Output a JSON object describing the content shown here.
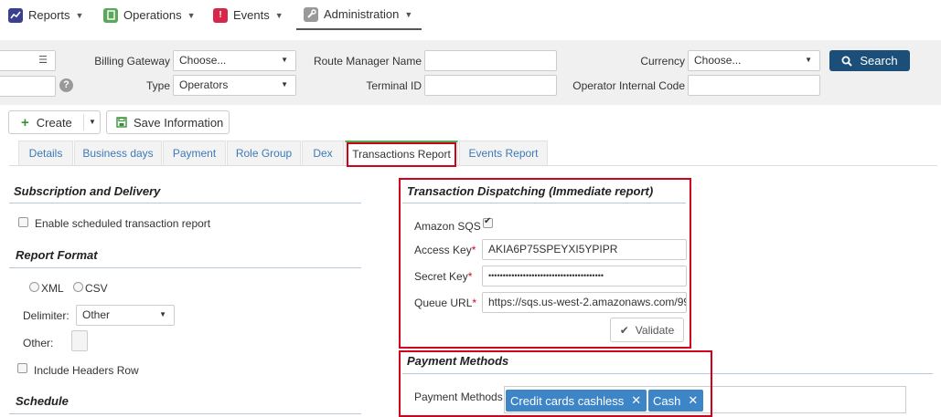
{
  "nav": {
    "reports": "Reports",
    "operations": "Operations",
    "events": "Events",
    "administration": "Administration"
  },
  "filters": {
    "billing_gateway_label": "Billing Gateway",
    "billing_gateway_value": "Choose...",
    "type_label": "Type",
    "type_value": "Operators",
    "route_manager_label": "Route Manager Name",
    "route_manager_value": "",
    "terminal_id_label": "Terminal ID",
    "terminal_id_value": "",
    "currency_label": "Currency",
    "currency_value": "Choose...",
    "operator_code_label": "Operator Internal Code",
    "operator_code_value": "",
    "search_label": "Search"
  },
  "toolbar": {
    "create_label": "Create",
    "save_label": "Save Information"
  },
  "tabs": [
    "Details",
    "Business days",
    "Payment",
    "Role Group",
    "Dex",
    "Transactions Report",
    "Events Report"
  ],
  "active_tab": "Transactions Report",
  "subscription": {
    "title": "Subscription and Delivery",
    "enable_label": "Enable scheduled transaction report",
    "enable_checked": false
  },
  "report_format": {
    "title": "Report Format",
    "xml_label": "XML",
    "csv_label": "CSV",
    "delimiter_label": "Delimiter:",
    "delimiter_value": "Other",
    "other_label": "Other:",
    "other_value": "",
    "headers_label": "Include Headers Row"
  },
  "schedule": {
    "title": "Schedule"
  },
  "dispatching": {
    "title": "Transaction Dispatching (Immediate report)",
    "sqs_label": "Amazon SQS",
    "sqs_checked": true,
    "access_key_label": "Access Key",
    "access_key_value": "AKIA6P75SPEYXI5YPIPR",
    "secret_key_label": "Secret Key",
    "secret_key_value": "••••••••••••••••••••••••••••••••••••••••",
    "queue_url_label": "Queue URL",
    "queue_url_value": "https://sqs.us-west-2.amazonaws.com/99",
    "required_marker": "*",
    "validate_label": "Validate"
  },
  "payment_methods": {
    "title": "Payment Methods",
    "field_label": "Payment Methods",
    "tags": [
      "Credit cards cashless",
      "Cash"
    ]
  },
  "colors": {
    "accent": "#1b4f7a",
    "tag": "#3d85c6",
    "highlight": "#d0021b",
    "active_tab": "#4caf50"
  }
}
